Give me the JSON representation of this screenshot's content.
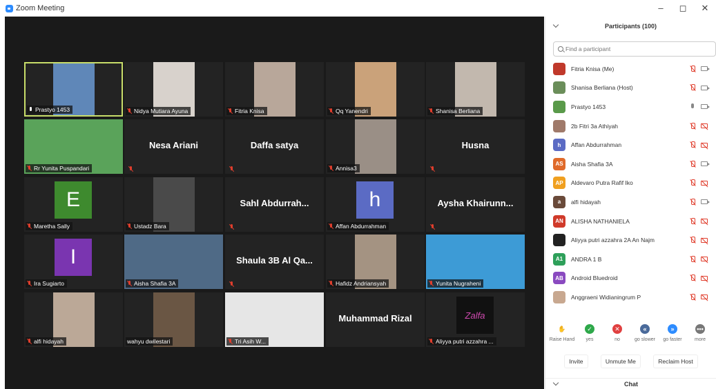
{
  "window": {
    "title": "Zoom Meeting",
    "minimize": "–",
    "maximize": "◻",
    "close": "✕"
  },
  "tiles": [
    {
      "name": "Prastyo 1453",
      "kind": "photo",
      "active": true,
      "bg": "#5f87b8",
      "mic": "on"
    },
    {
      "name": "Nidya Mutiara Ayuna",
      "kind": "photo",
      "bg": "#d8d2cc",
      "mic": "off"
    },
    {
      "name": "Fitria Knisa",
      "kind": "photo",
      "bg": "#b8a79a",
      "mic": "off"
    },
    {
      "name": "Qq Yanendri",
      "kind": "photo",
      "bg": "#caa27a",
      "mic": "off"
    },
    {
      "name": "Shanisa Berliana",
      "kind": "photo",
      "bg": "#c2b8ae",
      "mic": "off"
    },
    {
      "name": "Rr Yunita Puspandari",
      "kind": "photo",
      "wide": true,
      "bg": "#5aa35a",
      "mic": "off"
    },
    {
      "name": "Nesa Ariani",
      "kind": "name",
      "mic": "off"
    },
    {
      "name": "Daffa satya",
      "kind": "name",
      "mic": "off"
    },
    {
      "name": "Annisa3",
      "kind": "photo",
      "bg": "#9a8f86",
      "mic": "off"
    },
    {
      "name": "Husna",
      "kind": "name",
      "mic": "off"
    },
    {
      "name": "Maretha Sally",
      "kind": "avatar",
      "letter": "E",
      "bg": "#3e8a2e",
      "mic": "off"
    },
    {
      "name": "Ustadz Bara",
      "kind": "photo",
      "bg": "#4a4a4a",
      "mic": "off"
    },
    {
      "name": "Sahl Abdurrah...",
      "kind": "name",
      "mic": "off"
    },
    {
      "name": "Affan Abdurrahman",
      "kind": "avatar",
      "letter": "h",
      "bg": "#5b6bc4",
      "mic": "off"
    },
    {
      "name": "Aysha Khairunn...",
      "kind": "name",
      "mic": "off"
    },
    {
      "name": "Ira Sugiarto",
      "kind": "avatar",
      "letter": "I",
      "bg": "#7a35b0",
      "mic": "off"
    },
    {
      "name": "Aisha Shafia 3A",
      "kind": "photo",
      "wide": true,
      "bg": "#4f6a86",
      "mic": "off"
    },
    {
      "name": "Shaula 3B Al Qa...",
      "kind": "name",
      "mic": "off"
    },
    {
      "name": "Hafidz Andriansyah",
      "kind": "photo",
      "bg": "#a49382",
      "mic": "off"
    },
    {
      "name": "Yunita Nugraheni",
      "kind": "photo",
      "wide": true,
      "bg": "#3d9bd6",
      "mic": "off"
    },
    {
      "name": "alfi hidayah",
      "kind": "photo",
      "bg": "#bba897",
      "mic": "off"
    },
    {
      "name": "wahyu dwilestari",
      "kind": "photo",
      "bg": "#6a5644",
      "mic": "none"
    },
    {
      "name": "Tri Asih W...",
      "kind": "photo",
      "wide": true,
      "bg": "#e6e6e6",
      "mic": "off"
    },
    {
      "name": "Muhammad Rizal",
      "kind": "name",
      "mic": "none"
    },
    {
      "name": "Aliyya putri azzahra ...",
      "kind": "logo",
      "logo_text": "Zalfa",
      "bg": "#111",
      "mic": "off"
    }
  ],
  "panel": {
    "title": "Participants (100)",
    "search_placeholder": "Find a participant",
    "participants": [
      {
        "name": "Fitria Knisa (Me)",
        "avatar": "",
        "color": "#c0392b",
        "mic": "off",
        "cam": "on"
      },
      {
        "name": "Shanisa Berliana (Host)",
        "avatar": "",
        "color": "#6b8e5a",
        "mic": "off",
        "cam": "on"
      },
      {
        "name": "Prastyo 1453",
        "avatar": "",
        "color": "#5a9a4a",
        "mic": "on",
        "cam": "on"
      },
      {
        "name": "2b Fitri 3a Athiyah",
        "avatar": "",
        "color": "#a07a6a",
        "mic": "off",
        "cam": "off"
      },
      {
        "name": "Affan Abdurrahman",
        "avatar": "h",
        "color": "#5b6bc4",
        "mic": "off",
        "cam": "off"
      },
      {
        "name": "Aisha Shafia 3A",
        "avatar": "AS",
        "color": "#e06a2a",
        "mic": "off",
        "cam": "on"
      },
      {
        "name": "Aldevaro Putra Rafif Iko",
        "avatar": "AP",
        "color": "#f0a020",
        "mic": "off",
        "cam": "off"
      },
      {
        "name": "alfi hidayah",
        "avatar": "a",
        "color": "#6a4a3a",
        "mic": "off",
        "cam": "on"
      },
      {
        "name": "ALISHA NATHANIELA",
        "avatar": "AN",
        "color": "#d03a2a",
        "mic": "off",
        "cam": "off"
      },
      {
        "name": "Aliyya putri azzahra 2A An Najm",
        "avatar": "",
        "color": "#222",
        "mic": "off",
        "cam": "off"
      },
      {
        "name": "ANDRA 1 B",
        "avatar": "A1",
        "color": "#2ea05a",
        "mic": "off",
        "cam": "off"
      },
      {
        "name": "Android Bluedroid",
        "avatar": "AB",
        "color": "#8a4ac0",
        "mic": "off",
        "cam": "off"
      },
      {
        "name": "Anggraeni Widianingrum P",
        "avatar": "",
        "color": "#c8a890",
        "mic": "off",
        "cam": "off"
      }
    ],
    "reactions": [
      {
        "label": "Raise Hand",
        "color": "#ffffff",
        "glyph": "✋",
        "text_color": "#3a7bd5"
      },
      {
        "label": "yes",
        "color": "#2ea84a",
        "glyph": "✓",
        "text_color": "#fff"
      },
      {
        "label": "no",
        "color": "#e04040",
        "glyph": "✕",
        "text_color": "#fff"
      },
      {
        "label": "go slower",
        "color": "#4a6a9a",
        "glyph": "«",
        "text_color": "#fff"
      },
      {
        "label": "go faster",
        "color": "#2d8cff",
        "glyph": "»",
        "text_color": "#fff"
      },
      {
        "label": "more",
        "color": "#777777",
        "glyph": "•••",
        "text_color": "#fff"
      }
    ],
    "buttons": {
      "invite": "Invite",
      "unmute_me": "Unmute Me",
      "reclaim_host": "Reclaim Host"
    },
    "chat_title": "Chat"
  }
}
